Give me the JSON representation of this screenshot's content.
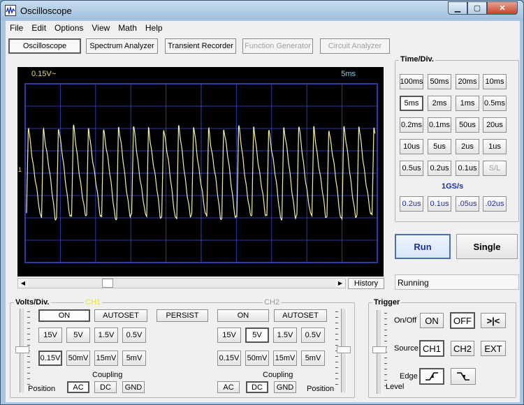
{
  "window": {
    "title": "Oscilloscope"
  },
  "menu": [
    "File",
    "Edit",
    "Options",
    "View",
    "Math",
    "Help"
  ],
  "toolbar": {
    "oscilloscope": "Oscilloscope",
    "spectrum": "Spectrum Analyzer",
    "transient": "Transient Recorder",
    "function_gen": "Function Generator",
    "circuit": "Circuit Analyzer"
  },
  "scope": {
    "volts_readout": "0.15V~",
    "time_readout": "5ms",
    "channel_marker": "1"
  },
  "history_label": "History",
  "timediv": {
    "title": "Time/Div.",
    "rows": [
      [
        "100ms",
        "50ms",
        "20ms",
        "10ms"
      ],
      [
        "5ms",
        "2ms",
        "1ms",
        "0.5ms"
      ],
      [
        "0.2ms",
        "0.1ms",
        "50us",
        "20us"
      ],
      [
        "10us",
        "5us",
        "2us",
        "1us"
      ],
      [
        "0.5us",
        "0.2us",
        "0.1us",
        "S/L"
      ]
    ],
    "rate_label": "1GS/s",
    "fast": [
      ".2us",
      ".1us",
      ".05us",
      ".02us"
    ]
  },
  "fast_display": [
    "0.2us",
    "0.1us",
    ".05us",
    ".02us"
  ],
  "run_label": "Run",
  "single_label": "Single",
  "status_text": "Running",
  "voltsdiv": {
    "title": "Volts/Div.",
    "ch1": {
      "label": "CH1",
      "on": "ON",
      "autoset": "AUTOSET",
      "row1": [
        "15V",
        "5V",
        "1.5V",
        "0.5V"
      ],
      "row2": [
        "0.15V",
        "50mV",
        "15mV",
        "5mV"
      ],
      "coupling_label": "Coupling",
      "coupling": [
        "AC",
        "DC",
        "GND"
      ],
      "position_label": "Position"
    },
    "persist": "PERSIST",
    "ch2": {
      "label": "CH2",
      "on": "ON",
      "autoset": "AUTOSET",
      "row1": [
        "15V",
        "5V",
        "1.5V",
        "0.5V"
      ],
      "row2": [
        "0.15V",
        "50mV",
        "15mV",
        "5mV"
      ],
      "coupling_label": "Coupling",
      "coupling": [
        "AC",
        "DC",
        "GND"
      ],
      "position_label": "Position"
    }
  },
  "trigger": {
    "title": "Trigger",
    "onoff_label": "On/Off",
    "on": "ON",
    "off": "OFF",
    "marker": ">|<",
    "source_label": "Source",
    "sources": [
      "CH1",
      "CH2",
      "EXT"
    ],
    "edge_label": "Edge",
    "level_label": "Level"
  },
  "colors": {
    "trace": "#f2f0a6",
    "grid": "#2d3aa8",
    "volts_readout": "#e8e260",
    "time_readout": "#7fd7e6",
    "ch1_label": "#f3e21b",
    "ch2_label": "#9a9a9a",
    "accent_blue": "#1a2fa6"
  }
}
